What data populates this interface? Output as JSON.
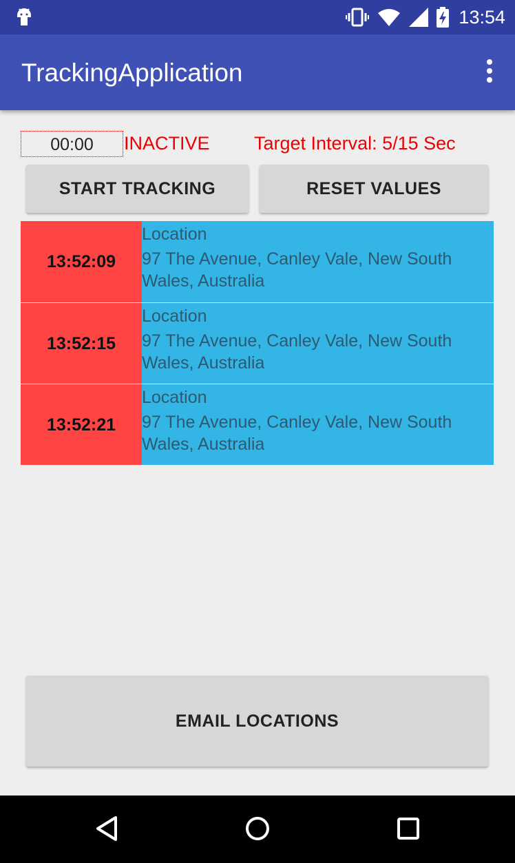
{
  "status_bar": {
    "time": "13:54",
    "icons": [
      "android-icon",
      "vibrate-icon",
      "wifi-icon",
      "signal-icon",
      "battery-charging-icon"
    ]
  },
  "app_bar": {
    "title": "TrackingApplication",
    "menu_icon": "more-vert-icon"
  },
  "tracker": {
    "timer": "00:00",
    "status": "INACTIVE",
    "interval": "Target Interval: 5/15 Sec"
  },
  "buttons": {
    "start": "START TRACKING",
    "reset": "RESET VALUES",
    "email": "EMAIL LOCATIONS"
  },
  "locations": [
    {
      "time": "13:52:09",
      "label": "Location",
      "address": "97 The Avenue, Canley Vale, New South Wales, Australia"
    },
    {
      "time": "13:52:15",
      "label": "Location",
      "address": "97 The Avenue, Canley Vale, New South Wales, Australia"
    },
    {
      "time": "13:52:21",
      "label": "Location",
      "address": "97 The Avenue, Canley Vale, New South Wales, Australia"
    }
  ],
  "colors": {
    "status_bar": "#303f9f",
    "app_bar": "#3f51b5",
    "time_cell": "#ff4444",
    "info_cell": "#33b5e5",
    "status_text": "#ee0000"
  },
  "nav": {
    "icons": [
      "back-icon",
      "home-icon",
      "recents-icon"
    ]
  }
}
